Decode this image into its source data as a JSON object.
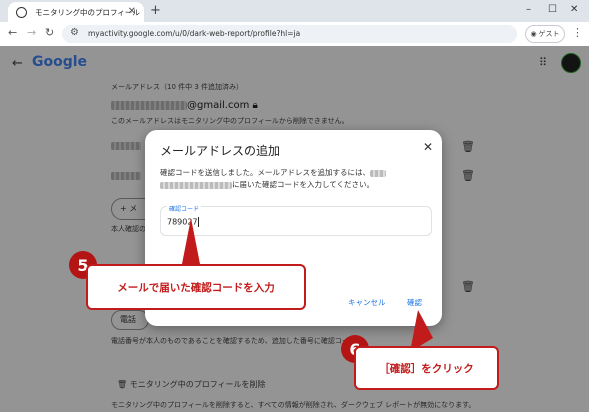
{
  "browser": {
    "tab_title": "モニタリング中のプロフィール",
    "url": "myactivity.google.com/u/0/dark-web-report/profile?hl=ja",
    "guest_label": "ゲスト"
  },
  "page": {
    "logo": "Google",
    "email_section_label": "メールアドレス（10 件中 3 件追加済み）",
    "email_suffix": "@gmail.com",
    "email_note": "このメールアドレスはモニタリング中のプロフィールから削除できません。",
    "add_email_button_fragment": "+ メ",
    "verify_note_fragment": "本人確認の",
    "phone_button_fragment": "電話",
    "phone_note": "電話番号が本人のものであることを確認するため、追加した番号に確認コードを",
    "delete_profile_label": "モニタリング中のプロフィールを削除",
    "delete_profile_note": "モニタリング中のプロフィールを削除すると、すべての情報が削除され、ダークウェブ レポートが無効になります。"
  },
  "dialog": {
    "title": "メールアドレスの追加",
    "description_1": "確認コードを送信しました。メールアドレスを追加するには、",
    "description_2": "に届いた確認コードを入力してください。",
    "field_label": "確認コード",
    "field_value": "789027",
    "cancel_label": "キャンセル",
    "confirm_label": "確認"
  },
  "annotations": {
    "step5_number": "5",
    "step5_text": "メールで届いた確認コードを入力",
    "step6_number": "6",
    "step6_text": "［確認］をクリック",
    "color": "#c21b1b"
  }
}
